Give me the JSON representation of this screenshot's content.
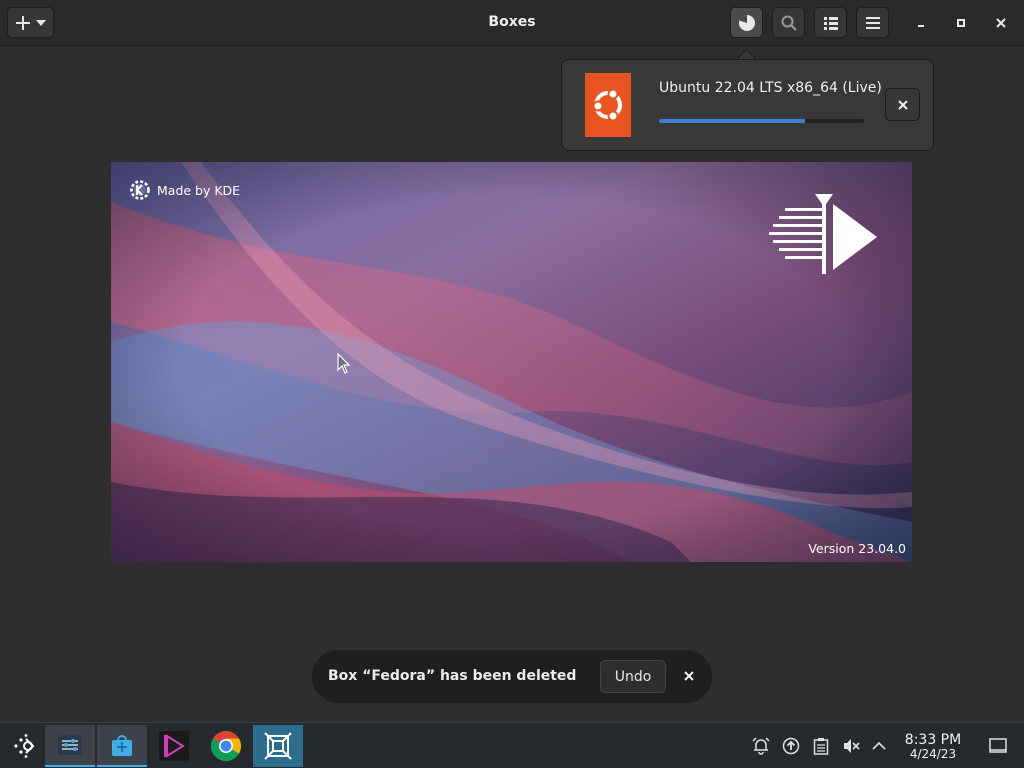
{
  "header": {
    "title": "Boxes",
    "new_icon": "plus-icon",
    "dropdown_icon": "chevron-down-icon",
    "buttons": [
      "downloads-icon",
      "search-icon",
      "list-view-icon",
      "menu-icon"
    ],
    "window_controls": [
      "minimize-icon",
      "maximize-icon",
      "close-icon"
    ]
  },
  "download": {
    "name": "Ubuntu 22.04 LTS x86_64 (Live)",
    "progress": 0.71,
    "accent": "#e95420",
    "cancel_icon": "close-icon"
  },
  "display": {
    "made_by": "Made by KDE",
    "version": "Version 23.04.0"
  },
  "toast": {
    "message": "Box “Fedora” has been deleted",
    "undo_label": "Undo",
    "close_icon": "close-icon"
  },
  "taskbar": {
    "launcher_icon": "steamdeck-launcher-icon",
    "apps": [
      "system-settings-icon",
      "discover-store-icon",
      "kdenlive-icon",
      "chrome-icon",
      "boxes-icon"
    ],
    "tray": [
      "notifications-icon",
      "updates-icon",
      "clipboard-icon",
      "volume-muted-icon",
      "show-hidden-icon"
    ],
    "time": "8:33 PM",
    "date": "4/24/23",
    "show_desktop_icon": "show-desktop-icon"
  },
  "colors": {
    "progress": "#3f7fd4",
    "active_indicator": "#3daee9"
  }
}
